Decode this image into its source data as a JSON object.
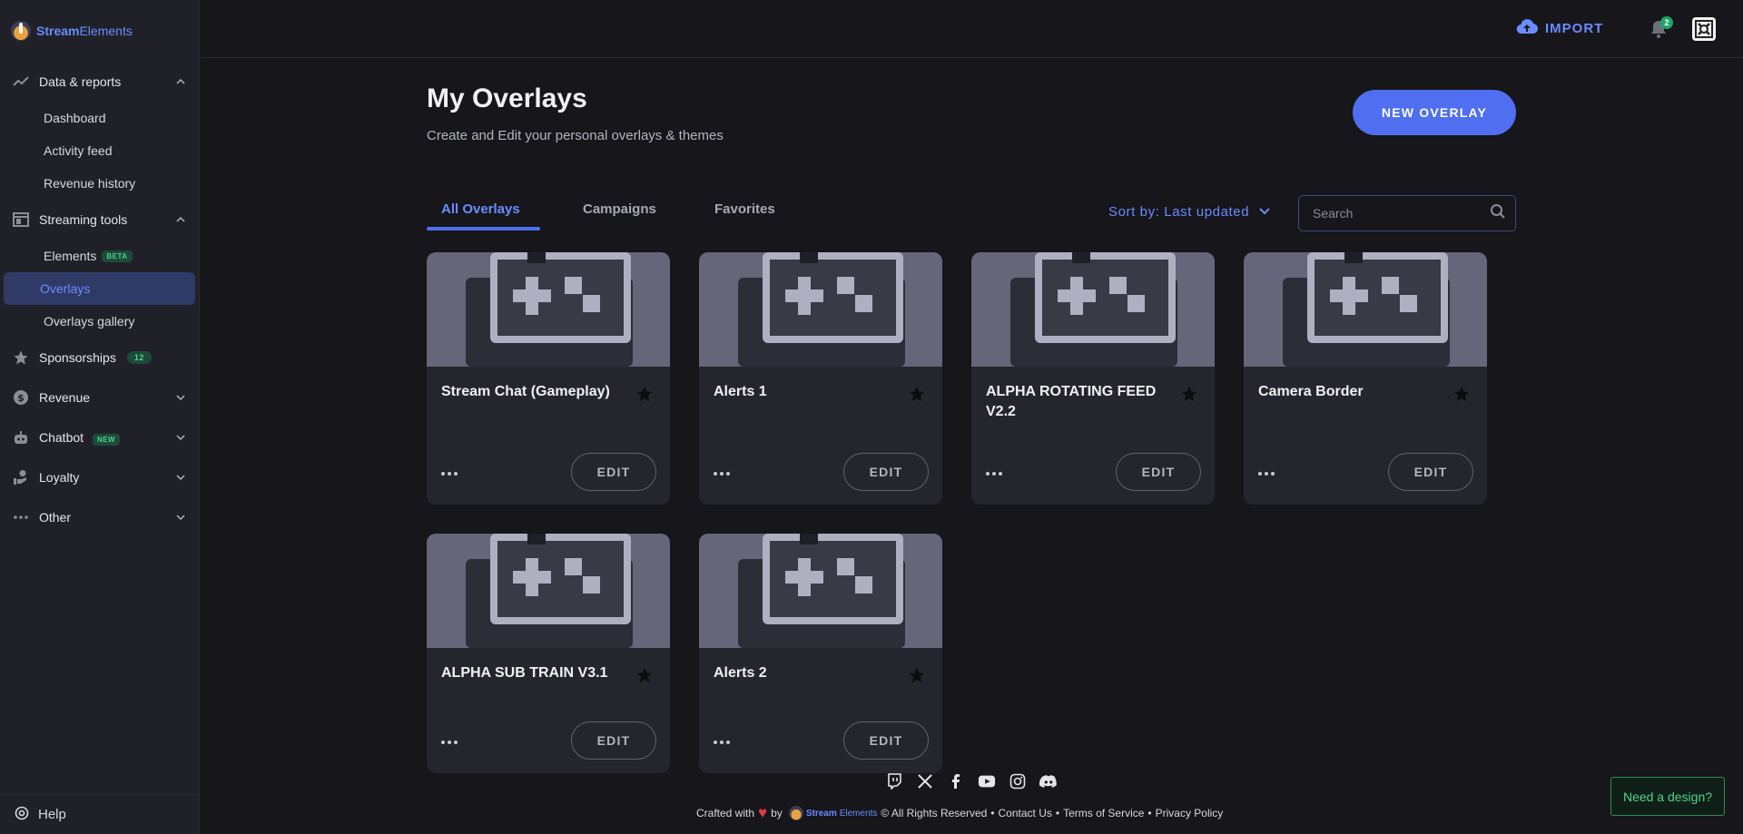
{
  "app": {
    "brand_prefix": "Stream",
    "brand_suffix": "Elements"
  },
  "sidebar": {
    "groups": [
      {
        "label": "Data & reports",
        "icon": "trending-chart-icon",
        "expanded": true,
        "items": [
          {
            "label": "Dashboard"
          },
          {
            "label": "Activity feed"
          },
          {
            "label": "Revenue history"
          }
        ]
      },
      {
        "label": "Streaming tools",
        "icon": "layout-icon",
        "expanded": true,
        "items": [
          {
            "label": "Elements",
            "badge": "BETA"
          },
          {
            "label": "Overlays",
            "active": true
          },
          {
            "label": "Overlays gallery"
          }
        ]
      },
      {
        "label": "Sponsorships",
        "icon": "star-icon",
        "badge": "12"
      },
      {
        "label": "Revenue",
        "icon": "dollar-icon"
      },
      {
        "label": "Chatbot",
        "icon": "robot-icon",
        "badge": "NEW"
      },
      {
        "label": "Loyalty",
        "icon": "loyalty-hand-icon"
      },
      {
        "label": "Other",
        "icon": "more-dots-icon"
      }
    ],
    "help_label": "Help"
  },
  "topbar": {
    "import_label": "IMPORT",
    "notification_count": "2"
  },
  "header": {
    "title": "My Overlays",
    "subtitle": "Create and Edit your personal overlays & themes",
    "new_overlay_label": "NEW OVERLAY"
  },
  "tabs": [
    {
      "label": "All Overlays",
      "active": true
    },
    {
      "label": "Campaigns"
    },
    {
      "label": "Favorites"
    }
  ],
  "sort": {
    "label": "Sort by: Last updated"
  },
  "search": {
    "placeholder": "Search"
  },
  "overlays": [
    {
      "title": "Stream Chat (Gameplay)",
      "edit_label": "EDIT"
    },
    {
      "title": "Alerts 1",
      "edit_label": "EDIT"
    },
    {
      "title": "ALPHA ROTATING FEED V2.2",
      "edit_label": "EDIT"
    },
    {
      "title": "Camera Border",
      "edit_label": "EDIT"
    },
    {
      "title": "ALPHA SUB TRAIN V3.1",
      "edit_label": "EDIT"
    },
    {
      "title": "Alerts 2",
      "edit_label": "EDIT"
    }
  ],
  "footer": {
    "crafted_with": "Crafted with",
    "by": "by",
    "brand_prefix": "Stream",
    "brand_suffix": "Elements",
    "rights": "© All Rights Reserved",
    "links": [
      "Contact Us",
      "Terms of Service",
      "Privacy Policy"
    ],
    "socials": [
      "twitch-icon",
      "x-icon",
      "facebook-icon",
      "youtube-icon",
      "instagram-icon",
      "discord-icon"
    ],
    "need_design_label": "Need a design?"
  },
  "colors": {
    "accent": "#4f6ff0",
    "background": "#16161b",
    "sidebar": "#202128",
    "success": "#4fd18b"
  }
}
